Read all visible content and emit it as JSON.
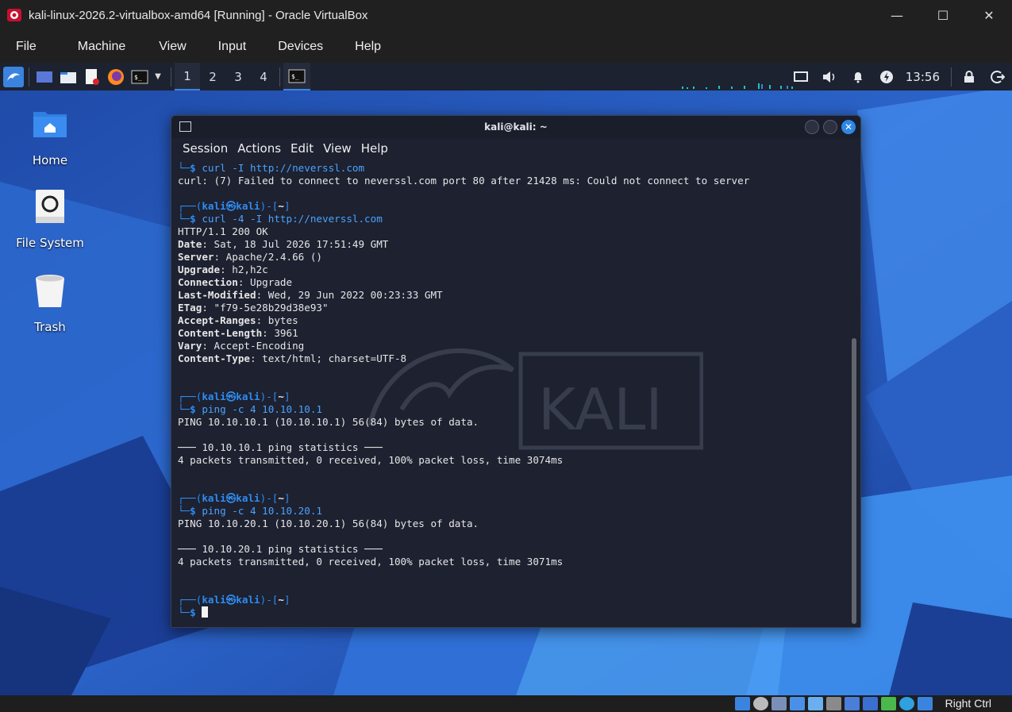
{
  "host": {
    "window_title": "kali-linux-2026.2-virtualbox-amd64 [Running] - Oracle VirtualBox",
    "menu": [
      "File",
      "Machine",
      "View",
      "Input",
      "Devices",
      "Help"
    ],
    "controls": {
      "minimize": "—",
      "maximize": "☐",
      "close": "✕"
    },
    "host_key": "Right Ctrl"
  },
  "panel": {
    "workspaces": [
      "1",
      "2",
      "3",
      "4"
    ],
    "active_workspace": 0,
    "clock": "13:56",
    "accent_color": "#3a84e0"
  },
  "desktop": {
    "icons": [
      {
        "label": "Home",
        "icon": "home-folder-icon"
      },
      {
        "label": "File System",
        "icon": "drive-icon"
      },
      {
        "label": "Trash",
        "icon": "trash-icon"
      }
    ]
  },
  "terminal": {
    "title": "kali@kali: ~",
    "menu": [
      "Session",
      "Actions",
      "Edit",
      "View",
      "Help"
    ],
    "prompt": {
      "user": "kali",
      "at": "㉿",
      "host": "kali",
      "dir": "~"
    },
    "lines": [
      {
        "type": "cmd_tail",
        "text": "curl -I http://neverssl.com"
      },
      {
        "type": "out",
        "text": "curl: (7) Failed to connect to neverssl.com port 80 after 21428 ms: Could not connect to server"
      },
      {
        "type": "blank"
      },
      {
        "type": "prompt"
      },
      {
        "type": "cmd_tail",
        "text": "curl -4 -I http://neverssl.com"
      },
      {
        "type": "out",
        "text": "HTTP/1.1 200 OK"
      },
      {
        "type": "hdr",
        "key": "Date",
        "val": ": Sat, 18 Jul 2026 17:51:49 GMT"
      },
      {
        "type": "hdr",
        "key": "Server",
        "val": ": Apache/2.4.66 ()"
      },
      {
        "type": "hdr",
        "key": "Upgrade",
        "val": ": h2,h2c"
      },
      {
        "type": "hdr",
        "key": "Connection",
        "val": ": Upgrade"
      },
      {
        "type": "hdr",
        "key": "Last-Modified",
        "val": ": Wed, 29 Jun 2022 00:23:33 GMT"
      },
      {
        "type": "hdr",
        "key": "ETag",
        "val": ": \"f79-5e28b29d38e93\""
      },
      {
        "type": "hdr",
        "key": "Accept-Ranges",
        "val": ": bytes"
      },
      {
        "type": "hdr",
        "key": "Content-Length",
        "val": ": 3961"
      },
      {
        "type": "hdr",
        "key": "Vary",
        "val": ": Accept-Encoding"
      },
      {
        "type": "hdr",
        "key": "Content-Type",
        "val": ": text/html; charset=UTF-8"
      },
      {
        "type": "blank"
      },
      {
        "type": "blank"
      },
      {
        "type": "prompt"
      },
      {
        "type": "cmd_tail",
        "text": "ping -c 4 10.10.10.1"
      },
      {
        "type": "out",
        "text": "PING 10.10.10.1 (10.10.10.1) 56(84) bytes of data."
      },
      {
        "type": "blank"
      },
      {
        "type": "out",
        "text": "─── 10.10.10.1 ping statistics ───"
      },
      {
        "type": "out",
        "text": "4 packets transmitted, 0 received, 100% packet loss, time 3074ms"
      },
      {
        "type": "blank"
      },
      {
        "type": "blank"
      },
      {
        "type": "prompt"
      },
      {
        "type": "cmd_tail",
        "text": "ping -c 4 10.10.20.1"
      },
      {
        "type": "out",
        "text": "PING 10.10.20.1 (10.10.20.1) 56(84) bytes of data."
      },
      {
        "type": "blank"
      },
      {
        "type": "out",
        "text": "─── 10.10.20.1 ping statistics ───"
      },
      {
        "type": "out",
        "text": "4 packets transmitted, 0 received, 100% packet loss, time 3071ms"
      },
      {
        "type": "blank"
      },
      {
        "type": "blank"
      },
      {
        "type": "prompt"
      },
      {
        "type": "cursor_line"
      }
    ],
    "watermark": "KALI"
  }
}
